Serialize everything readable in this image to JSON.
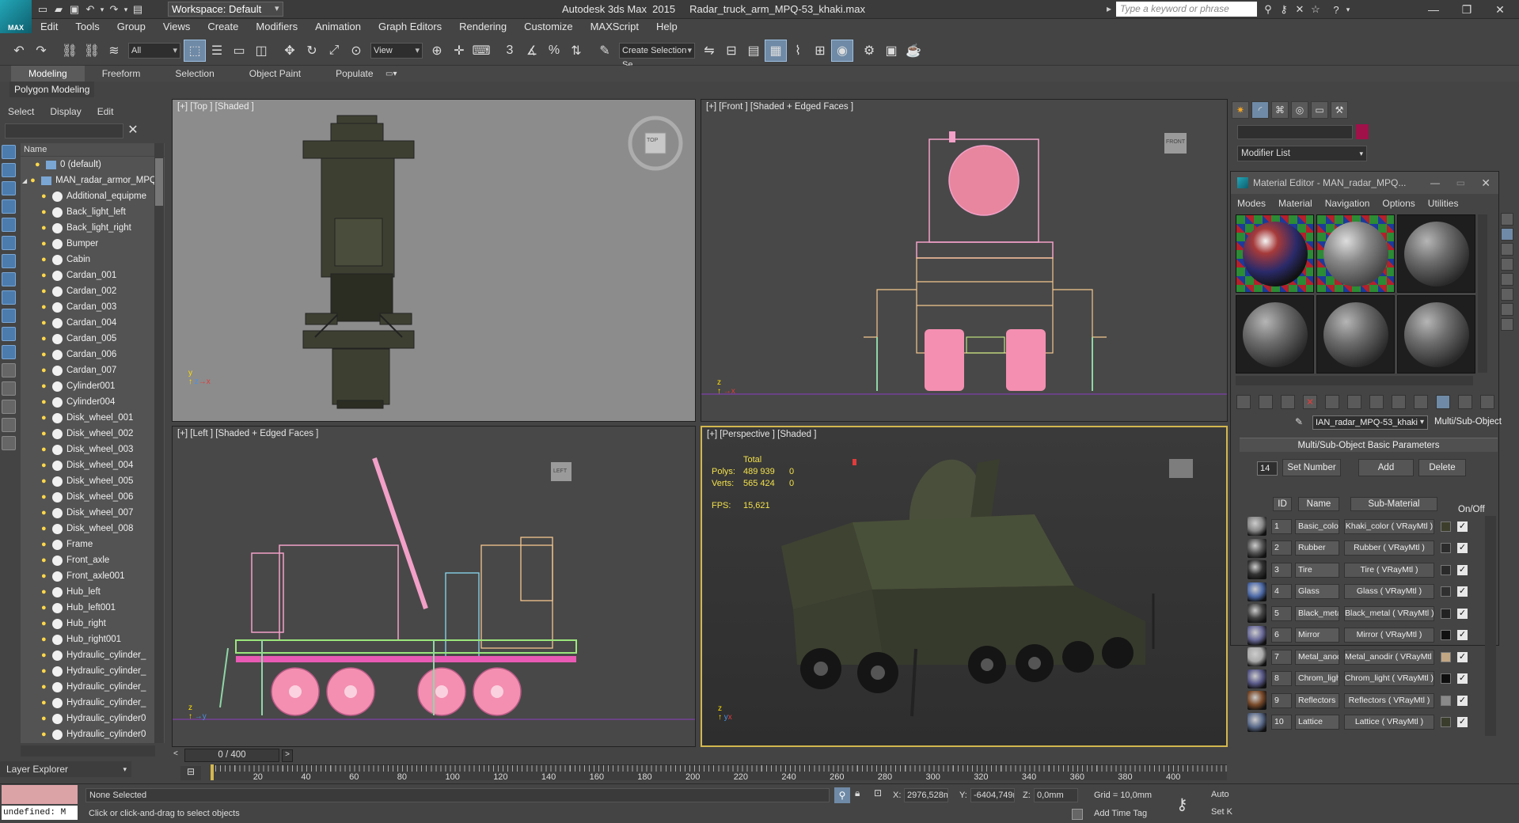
{
  "titlebar": {
    "workspace": "Workspace: Default",
    "title": "Autodesk 3ds Max  2015     Radar_truck_arm_MPQ-53_khaki.max",
    "search_placeholder": "Type a keyword or phrase",
    "logo": "MAX"
  },
  "menu": [
    "Edit",
    "Tools",
    "Group",
    "Views",
    "Create",
    "Modifiers",
    "Animation",
    "Graph Editors",
    "Rendering",
    "Customize",
    "MAXScript",
    "Help"
  ],
  "toolbar": {
    "filter": "All",
    "refcoord": "View",
    "snap": "3",
    "selset_placeholder": "Create Selection Se"
  },
  "ribbon": {
    "tabs": [
      "Modeling",
      "Freeform",
      "Selection",
      "Object Paint",
      "Populate"
    ],
    "active": "Modeling",
    "sub": "Polygon Modeling"
  },
  "scene": {
    "menu": [
      "Select",
      "Display",
      "Edit"
    ],
    "header": "Name",
    "items": [
      {
        "name": "0 (default)",
        "kind": "layer"
      },
      {
        "name": "MAN_radar_armor_MPQ",
        "kind": "layer"
      },
      {
        "name": "Additional_equipme",
        "kind": "obj"
      },
      {
        "name": "Back_light_left",
        "kind": "obj"
      },
      {
        "name": "Back_light_right",
        "kind": "obj"
      },
      {
        "name": "Bumper",
        "kind": "obj"
      },
      {
        "name": "Cabin",
        "kind": "obj"
      },
      {
        "name": "Cardan_001",
        "kind": "obj"
      },
      {
        "name": "Cardan_002",
        "kind": "obj"
      },
      {
        "name": "Cardan_003",
        "kind": "obj"
      },
      {
        "name": "Cardan_004",
        "kind": "obj"
      },
      {
        "name": "Cardan_005",
        "kind": "obj"
      },
      {
        "name": "Cardan_006",
        "kind": "obj"
      },
      {
        "name": "Cardan_007",
        "kind": "obj"
      },
      {
        "name": "Cylinder001",
        "kind": "obj"
      },
      {
        "name": "Cylinder004",
        "kind": "obj"
      },
      {
        "name": "Disk_wheel_001",
        "kind": "obj"
      },
      {
        "name": "Disk_wheel_002",
        "kind": "obj"
      },
      {
        "name": "Disk_wheel_003",
        "kind": "obj"
      },
      {
        "name": "Disk_wheel_004",
        "kind": "obj"
      },
      {
        "name": "Disk_wheel_005",
        "kind": "obj"
      },
      {
        "name": "Disk_wheel_006",
        "kind": "obj"
      },
      {
        "name": "Disk_wheel_007",
        "kind": "obj"
      },
      {
        "name": "Disk_wheel_008",
        "kind": "obj"
      },
      {
        "name": "Frame",
        "kind": "obj"
      },
      {
        "name": "Front_axle",
        "kind": "obj"
      },
      {
        "name": "Front_axle001",
        "kind": "obj"
      },
      {
        "name": "Hub_left",
        "kind": "obj"
      },
      {
        "name": "Hub_left001",
        "kind": "obj"
      },
      {
        "name": "Hub_right",
        "kind": "obj"
      },
      {
        "name": "Hub_right001",
        "kind": "obj"
      },
      {
        "name": "Hydraulic_cylinder_",
        "kind": "obj"
      },
      {
        "name": "Hydraulic_cylinder_",
        "kind": "obj"
      },
      {
        "name": "Hydraulic_cylinder_",
        "kind": "obj"
      },
      {
        "name": "Hydraulic_cylinder_",
        "kind": "obj"
      },
      {
        "name": "Hydraulic_cylinder0",
        "kind": "obj"
      },
      {
        "name": "Hydraulic_cylinder0",
        "kind": "obj"
      }
    ],
    "footer": "Layer Explorer"
  },
  "viewports": {
    "top": "[+] [Top ] [Shaded ]",
    "front": "[+] [Front ] [Shaded + Edged Faces ]",
    "left": "[+] [Left ] [Shaded + Edged Faces ]",
    "persp": "[+] [Perspective ] [Shaded ]",
    "cube_top": "TOP",
    "cube_front": "FRONT",
    "cube_left": "LEFT",
    "stats": {
      "total": "Total",
      "polys_label": "Polys:",
      "polys": "489 939",
      "polys_sel": "0",
      "verts_label": "Verts:",
      "verts": "565 424",
      "verts_sel": "0",
      "fps_label": "FPS:",
      "fps": "15,621"
    }
  },
  "command": {
    "modifier_list": "Modifier List",
    "object_color": "#a0114a"
  },
  "material_editor": {
    "title": "Material Editor - MAN_radar_MPQ...",
    "menu": [
      "Modes",
      "Material",
      "Navigation",
      "Options",
      "Utilities"
    ],
    "mat_name": "IAN_radar_MPQ-53_khaki",
    "mat_type": "Multi/Sub-Object",
    "rollout": "Multi/Sub-Object Basic Parameters",
    "count": "14",
    "set_number": "Set Number",
    "add": "Add",
    "delete": "Delete",
    "col_id": "ID",
    "col_name": "Name",
    "col_sub": "Sub-Material",
    "col_onoff": "On/Off",
    "rows": [
      {
        "id": "1",
        "name": "Basic_color",
        "sub": "Khaki_color  ( VRayMtl )",
        "color": "#3d3f2c"
      },
      {
        "id": "2",
        "name": "Rubber",
        "sub": "Rubber  ( VRayMtl )",
        "color": "#2c2c2c"
      },
      {
        "id": "3",
        "name": "Tire",
        "sub": "Tire  ( VRayMtl )",
        "color": "#2a2a2a"
      },
      {
        "id": "4",
        "name": "Glass",
        "sub": "Glass  ( VRayMtl )",
        "color": "#303030"
      },
      {
        "id": "5",
        "name": "Black_metal",
        "sub": "Black_metal  ( VRayMtl )",
        "color": "#222222"
      },
      {
        "id": "6",
        "name": "Mirror",
        "sub": "Mirror  ( VRayMtl )",
        "color": "#111111"
      },
      {
        "id": "7",
        "name": "Metal_anodir",
        "sub": "Metal_anodir  ( VRayMtl )",
        "color": "#c2a784"
      },
      {
        "id": "8",
        "name": "Chrom_light",
        "sub": "Chrom_light  ( VRayMtl )",
        "color": "#0e0e0e"
      },
      {
        "id": "9",
        "name": "Reflectors",
        "sub": "Reflectors  ( VRayMtl )",
        "color": "#8a8a8a"
      },
      {
        "id": "10",
        "name": "Lattice",
        "sub": "Lattice  ( VRayMtl )",
        "color": "#3a3d2c"
      }
    ]
  },
  "timeline": {
    "frame": "0 / 400",
    "ticks": [
      "20",
      "40",
      "60",
      "80",
      "100",
      "120",
      "140",
      "160",
      "180",
      "200",
      "220",
      "240",
      "260",
      "280",
      "300",
      "320",
      "340",
      "360",
      "380",
      "400"
    ]
  },
  "status": {
    "maxscript": "undefined: M",
    "selection": "None Selected",
    "prompt": "Click or click-and-drag to select objects",
    "x_label": "X:",
    "x": "2976,528m",
    "y_label": "Y:",
    "y": "-6404,749n",
    "z_label": "Z:",
    "z": "0,0mm",
    "grid": "Grid = 10,0mm",
    "auto": "Auto",
    "setk": "Set K",
    "add_time_tag": "Add Time Tag"
  }
}
